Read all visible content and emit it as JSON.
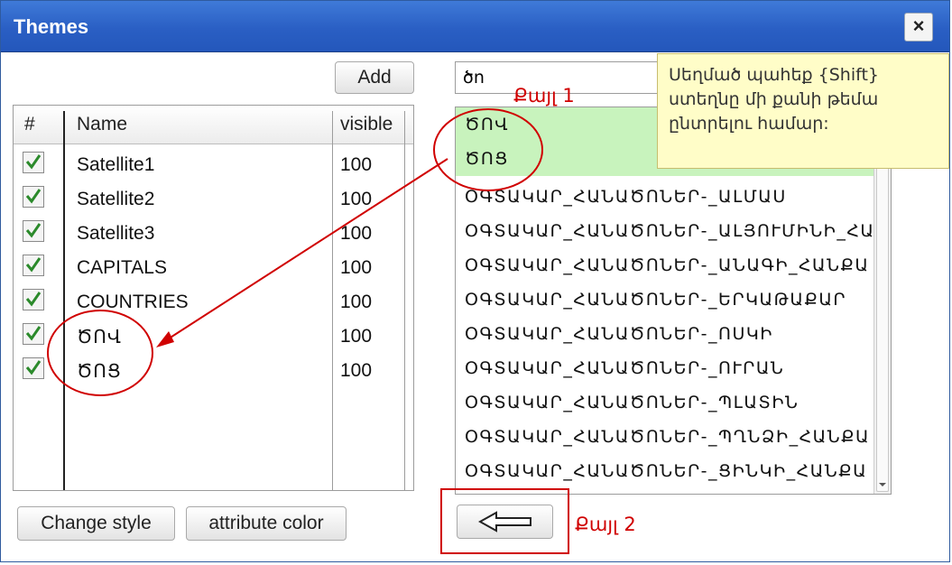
{
  "window": {
    "title": "Themes",
    "close_label": "×"
  },
  "buttons": {
    "add": "Add",
    "change_style": "Change style",
    "attribute_color": "attribute color"
  },
  "layers_table": {
    "headers": {
      "check": "#",
      "name": "Name",
      "visible": "visible"
    },
    "rows": [
      {
        "name": "Satellite1",
        "visible": "100",
        "checked": true
      },
      {
        "name": "Satellite2",
        "visible": "100",
        "checked": true
      },
      {
        "name": "Satellite3",
        "visible": "100",
        "checked": true
      },
      {
        "name": "CAPITALS",
        "visible": "100",
        "checked": true
      },
      {
        "name": "COUNTRIES",
        "visible": "100",
        "checked": true
      },
      {
        "name": "ԾՈՎ",
        "visible": "100",
        "checked": true
      },
      {
        "name": "ԾՈՑ",
        "visible": "100",
        "checked": true
      }
    ]
  },
  "search": {
    "value": "ծո"
  },
  "theme_list": {
    "items": [
      {
        "label": "ԾՈՎ",
        "selected": true
      },
      {
        "label": "ԾՈՑ",
        "selected": true
      },
      {
        "label": "ՕԳՏԱԿԱՐ_ՀԱՆԱԾՈՆԵՐ-_ԱԼՄԱՍ",
        "selected": false
      },
      {
        "label": "ՕԳՏԱԿԱՐ_ՀԱՆԱԾՈՆԵՐ-_ԱԼՅՈՒՄԻՆԻ_ՀԱ",
        "selected": false
      },
      {
        "label": "ՕԳՏԱԿԱՐ_ՀԱՆԱԾՈՆԵՐ-_ԱՆԱԳԻ_ՀԱՆՔԱ",
        "selected": false
      },
      {
        "label": "ՕԳՏԱԿԱՐ_ՀԱՆԱԾՈՆԵՐ-_ԵՐԿԱԹԱՔԱՐ",
        "selected": false
      },
      {
        "label": "ՕԳՏԱԿԱՐ_ՀԱՆԱԾՈՆԵՐ-_ՈՍԿԻ",
        "selected": false
      },
      {
        "label": "ՕԳՏԱԿԱՐ_ՀԱՆԱԾՈՆԵՐ-_ՈՒՐԱՆ",
        "selected": false
      },
      {
        "label": "ՕԳՏԱԿԱՐ_ՀԱՆԱԾՈՆԵՐ-_ՊԼԱՏԻՆ",
        "selected": false
      },
      {
        "label": "ՕԳՏԱԿԱՐ_ՀԱՆԱԾՈՆԵՐ-_ՊՂՆՁԻ_ՀԱՆՔԱ",
        "selected": false
      },
      {
        "label": "ՕԳՏԱԿԱՐ_ՀԱՆԱԾՈՆԵՐ-_ՑԻՆԿԻ_ՀԱՆՔԱ",
        "selected": false
      }
    ]
  },
  "tooltip": {
    "text": "Սեղմած պահեք {Shift} ստեղնը մի քանի թեմա ընտրելու համար:"
  },
  "annotations": {
    "step1": "Քայլ 1",
    "step2": "Քայլ 2",
    "color": "#d00000"
  },
  "colors": {
    "titlebar": "#2a5fc4",
    "selection": "#c8f3bd",
    "tooltip_bg": "#fffdc8"
  },
  "icons": {
    "close": "close-icon",
    "arrow": "arrow-left-icon",
    "check": "check-icon",
    "scroll_down": "chevron-down-icon"
  }
}
